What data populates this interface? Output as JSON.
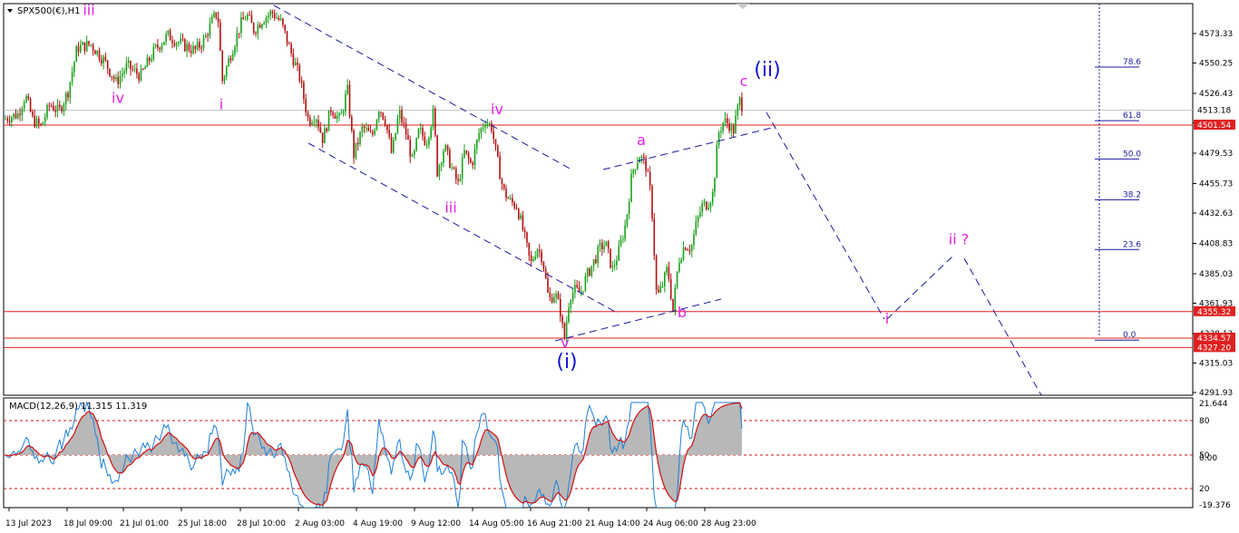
{
  "header": {
    "symbol_label": "SPX500(€),H1",
    "macd_label": "MACD(12,26,9) 11.315 11.319"
  },
  "colors": {
    "candle_up": "#1aa01a",
    "candle_down": "#b01010",
    "hline": "#e02020",
    "channel": "#1a1aa0",
    "wave_minor": "#e020e0",
    "wave_major": "#1010d0",
    "fib": "#1a1aa0",
    "macd_hist": "#b8b8b8",
    "macd_main": "#1e7fd8",
    "macd_signal": "#d01010"
  },
  "chart_data": [
    {
      "type": "candlestick",
      "title": "SPX500(€),H1",
      "x_ticks": [
        "13 Jul 2023",
        "18 Jul 09:00",
        "21 Jul 01:00",
        "25 Jul 18:00",
        "28 Jul 10:00",
        "2 Aug 03:00",
        "4 Aug 19:00",
        "9 Aug 12:00",
        "14 Aug 05:00",
        "16 Aug 21:00",
        "21 Aug 14:00",
        "24 Aug 06:00",
        "28 Aug 23:00"
      ],
      "y_ticks": [
        4573.33,
        4550.25,
        4526.43,
        4503.33,
        4479.53,
        4455.73,
        4432.63,
        4408.83,
        4385.03,
        4361.93,
        4338.13,
        4315.03,
        4291.93
      ],
      "ylim": [
        4287,
        4590
      ],
      "price_path": [
        [
          0,
          4505
        ],
        [
          10,
          4508
        ],
        [
          20,
          4510
        ],
        [
          28,
          4525
        ],
        [
          36,
          4506
        ],
        [
          45,
          4500
        ],
        [
          55,
          4518
        ],
        [
          65,
          4512
        ],
        [
          75,
          4528
        ],
        [
          85,
          4562
        ],
        [
          100,
          4565
        ],
        [
          115,
          4552
        ],
        [
          128,
          4535
        ],
        [
          140,
          4548
        ],
        [
          155,
          4540
        ],
        [
          170,
          4560
        ],
        [
          185,
          4572
        ],
        [
          200,
          4565
        ],
        [
          215,
          4560
        ],
        [
          225,
          4568
        ],
        [
          235,
          4585
        ],
        [
          240,
          4590
        ],
        [
          245,
          4536
        ],
        [
          252,
          4552
        ],
        [
          258,
          4565
        ],
        [
          265,
          4580
        ],
        [
          272,
          4588
        ],
        [
          280,
          4576
        ],
        [
          290,
          4585
        ],
        [
          300,
          4590
        ],
        [
          310,
          4582
        ],
        [
          320,
          4560
        ],
        [
          330,
          4540
        ],
        [
          340,
          4505
        ],
        [
          348,
          4510
        ],
        [
          356,
          4490
        ],
        [
          365,
          4515
        ],
        [
          375,
          4505
        ],
        [
          383,
          4530
        ],
        [
          390,
          4478
        ],
        [
          400,
          4500
        ],
        [
          410,
          4492
        ],
        [
          418,
          4516
        ],
        [
          425,
          4505
        ],
        [
          432,
          4478
        ],
        [
          440,
          4512
        ],
        [
          448,
          4494
        ],
        [
          455,
          4472
        ],
        [
          462,
          4498
        ],
        [
          470,
          4488
        ],
        [
          478,
          4512
        ],
        [
          482,
          4465
        ],
        [
          490,
          4485
        ],
        [
          498,
          4468
        ],
        [
          505,
          4455
        ],
        [
          512,
          4480
        ],
        [
          520,
          4470
        ],
        [
          528,
          4495
        ],
        [
          535,
          4505
        ],
        [
          542,
          4500
        ],
        [
          548,
          4475
        ],
        [
          555,
          4450
        ],
        [
          562,
          4442
        ],
        [
          570,
          4438
        ],
        [
          578,
          4415
        ],
        [
          585,
          4392
        ],
        [
          592,
          4406
        ],
        [
          598,
          4398
        ],
        [
          605,
          4364
        ],
        [
          612,
          4370
        ],
        [
          618,
          4355
        ],
        [
          622,
          4332
        ],
        [
          628,
          4368
        ],
        [
          634,
          4372
        ],
        [
          640,
          4370
        ],
        [
          648,
          4385
        ],
        [
          655,
          4395
        ],
        [
          662,
          4406
        ],
        [
          668,
          4408
        ],
        [
          675,
          4388
        ],
        [
          682,
          4402
        ],
        [
          690,
          4425
        ],
        [
          697,
          4465
        ],
        [
          705,
          4478
        ],
        [
          712,
          4470
        ],
        [
          718,
          4445
        ],
        [
          724,
          4366
        ],
        [
          730,
          4375
        ],
        [
          736,
          4390
        ],
        [
          742,
          4356
        ],
        [
          748,
          4395
        ],
        [
          755,
          4408
        ],
        [
          762,
          4405
        ],
        [
          768,
          4425
        ],
        [
          774,
          4438
        ],
        [
          780,
          4440
        ],
        [
          786,
          4448
        ],
        [
          792,
          4495
        ],
        [
          798,
          4505
        ],
        [
          804,
          4502
        ],
        [
          808,
          4495
        ],
        [
          812,
          4510
        ],
        [
          816,
          4522
        ],
        [
          820,
          4512
        ]
      ],
      "horizontal_levels": [
        {
          "price": 4501.54,
          "label": "4501.54"
        },
        {
          "price": 4355.32,
          "label": "4355.32"
        },
        {
          "price": 4334.57,
          "label": "4334.57"
        },
        {
          "price": 4327.2,
          "label": "4327.20"
        }
      ],
      "current_price": {
        "price": 4513.18,
        "label": "4513.18"
      },
      "fibonacci": [
        {
          "label": "78.6",
          "price": 4547
        },
        {
          "label": "61.8",
          "price": 4505
        },
        {
          "label": "50.0",
          "price": 4475
        },
        {
          "label": "38.2",
          "price": 4443
        },
        {
          "label": "23.6",
          "price": 4404
        },
        {
          "label": "0.0",
          "price": 4333
        }
      ],
      "wave_labels": [
        {
          "text": "iii",
          "price": 4588,
          "color": "minor"
        },
        {
          "text": "iv",
          "price": 4519,
          "color": "minor"
        },
        {
          "text": "i",
          "price": 4514,
          "color": "minor"
        },
        {
          "text": "iv",
          "price": 4510,
          "color": "minor"
        },
        {
          "text": "iii",
          "price": 4433,
          "color": "minor"
        },
        {
          "text": "v",
          "price": 4327,
          "color": "minor"
        },
        {
          "text": "(i)",
          "price": 4311,
          "color": "major"
        },
        {
          "text": "a",
          "price": 4486,
          "color": "minor"
        },
        {
          "text": "b",
          "price": 4351,
          "color": "minor"
        },
        {
          "text": "c",
          "price": 4532,
          "color": "minor"
        },
        {
          "text": "(ii)",
          "price": 4540,
          "color": "major"
        },
        {
          "text": "i",
          "price": 4346,
          "color": "minor"
        },
        {
          "text": "ii ?",
          "price": 4408,
          "color": "minor"
        }
      ]
    },
    {
      "type": "macd",
      "title": "MACD(12,26,9) 11.315 11.319",
      "y_ticks": [
        21.644,
        80,
        50,
        0.0,
        20,
        -19.376
      ],
      "reference_levels": [
        80,
        50,
        20
      ]
    }
  ]
}
